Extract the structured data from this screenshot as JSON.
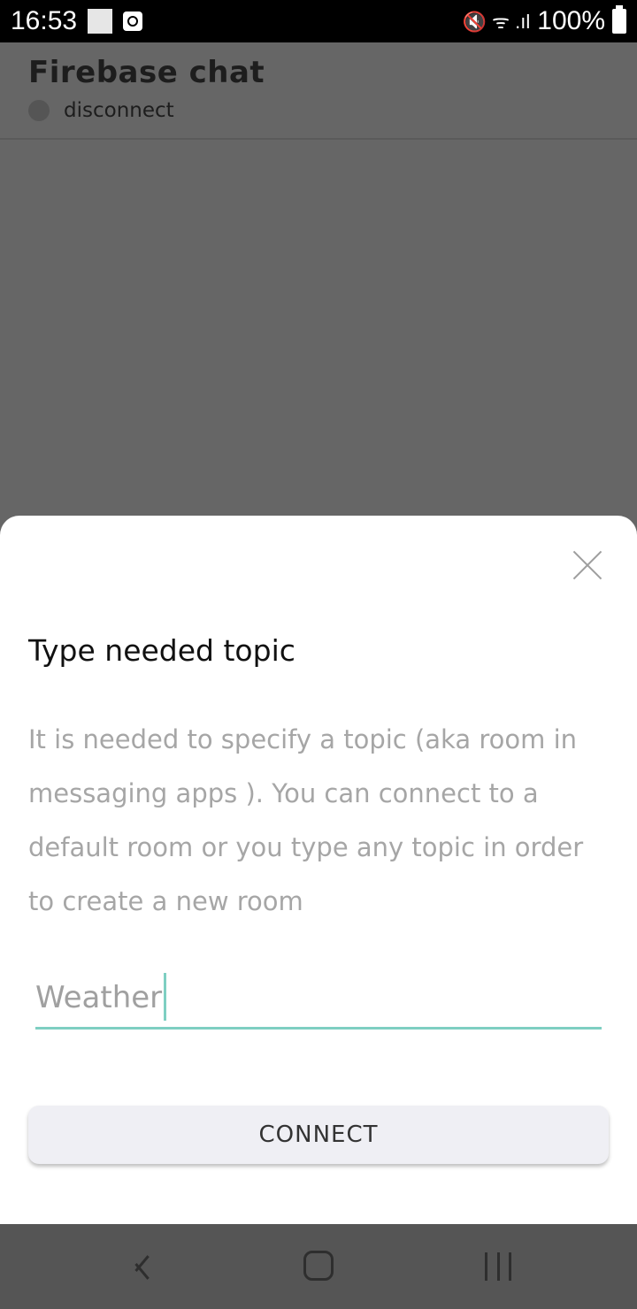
{
  "status_bar": {
    "time": "16:53",
    "signal_glyphs": "🔇 ᯤ .ıl",
    "battery": "100%"
  },
  "app": {
    "title": "Firebase chat",
    "connection_status": "disconnect"
  },
  "dialog": {
    "title": "Type needed topic",
    "description": "It is needed to specify a topic (aka room in messaging apps ). You can connect to a default room or you type any topic in order to create a new room",
    "topic_input": {
      "value": "Weather",
      "accent_color": "#7ecfc2"
    },
    "connect_label": "CONNECT"
  },
  "icons": {
    "close": "close-icon",
    "back": "back-icon",
    "home": "home-icon",
    "recent": "recent-apps-icon"
  }
}
